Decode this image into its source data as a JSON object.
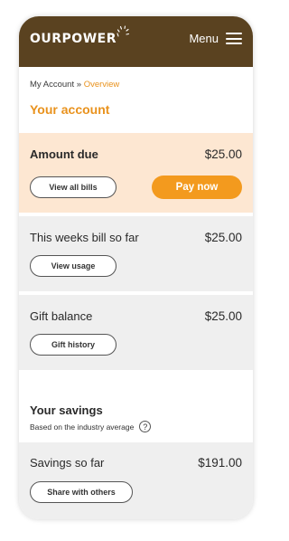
{
  "header": {
    "logo_text": "OURPOWER",
    "menu_label": "Menu",
    "bg_color": "#5a4220"
  },
  "breadcrumb": {
    "parent": "My Account",
    "separator": "»",
    "current": "Overview"
  },
  "page_title": "Your account",
  "amount_due": {
    "label": "Amount due",
    "amount": "$25.00",
    "view_bills_label": "View all bills",
    "pay_now_label": "Pay now"
  },
  "bill_so_far": {
    "label": "This weeks bill so far",
    "amount": "$25.00",
    "button_label": "View usage"
  },
  "gift": {
    "label": "Gift balance",
    "amount": "$25.00",
    "button_label": "Gift history"
  },
  "savings": {
    "title": "Your savings",
    "subtitle": "Based on the industry average",
    "help_icon": "?",
    "label": "Savings so far",
    "amount": "$191.00",
    "button_label": "Share with others"
  },
  "colors": {
    "accent": "#e9921d",
    "button_orange": "#f39a1e",
    "due_card_bg": "#fde7d2",
    "card_bg": "#efefef"
  }
}
